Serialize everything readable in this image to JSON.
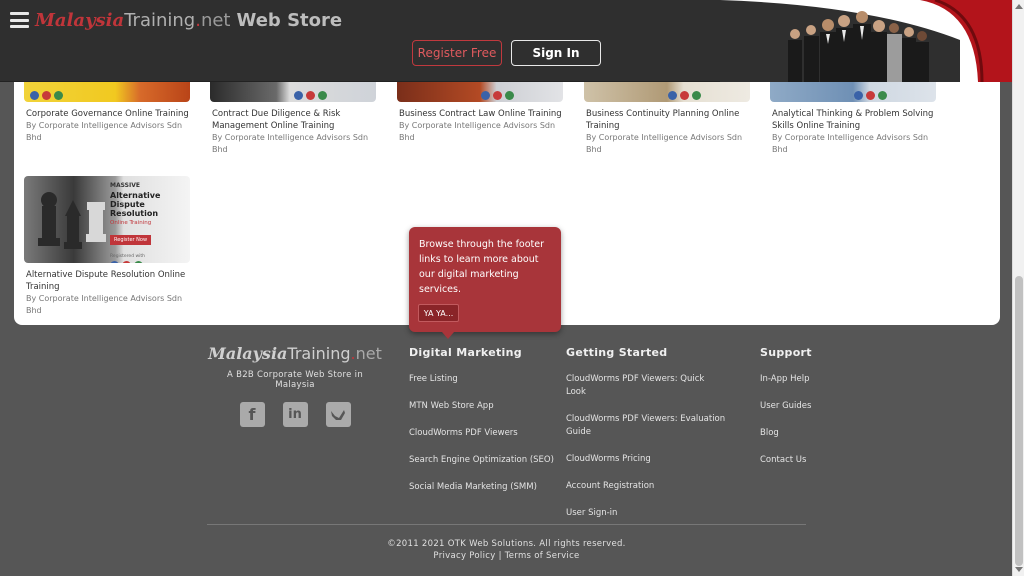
{
  "header": {
    "logo": {
      "malaysia": "Malaysia",
      "training": "Training",
      "dot": ".",
      "net": "net",
      "suffix": "Web Store"
    },
    "register_label": "Register Free",
    "signin_label": "Sign In"
  },
  "courses": [
    {
      "title": "Corporate Governance Online Training",
      "author": "By Corporate Intelligence Advisors Sdn Bhd"
    },
    {
      "title": "Contract Due Diligence & Risk Management Online Training",
      "author": "By Corporate Intelligence Advisors Sdn Bhd"
    },
    {
      "title": "Business Contract Law Online Training",
      "author": "By Corporate Intelligence Advisors Sdn Bhd"
    },
    {
      "title": "Business Continuity Planning Online Training",
      "author": "By Corporate Intelligence Advisors Sdn Bhd"
    },
    {
      "title": "Analytical Thinking & Problem Solving Skills Online Training",
      "author": "By Corporate Intelligence Advisors Sdn Bhd"
    },
    {
      "title": "Alternative Dispute Resolution Online Training",
      "author": "By Corporate Intelligence Advisors Sdn Bhd",
      "thumb_text": {
        "brand": "MASSIVE",
        "title": "Alternative Dispute Resolution",
        "sub": "Online Training",
        "cta": "Register Now",
        "reg": "Registered with"
      }
    }
  ],
  "tooltip": {
    "text": "Browse through the footer links to learn more about our digital marketing services.",
    "button": "YA YA..."
  },
  "footer": {
    "logo": {
      "malaysia": "Malaysia",
      "training": "Training",
      "dot": ".",
      "net": "net"
    },
    "tagline": "A B2B Corporate Web Store in Malaysia",
    "socials": [
      "facebook-icon",
      "linkedin-icon",
      "twitter-icon"
    ],
    "columns": {
      "digital_marketing": {
        "heading": "Digital Marketing",
        "links": [
          "Free Listing",
          "MTN Web Store App",
          "CloudWorms PDF Viewers",
          "Search Engine Optimization (SEO)",
          "Social Media Marketing (SMM)"
        ]
      },
      "getting_started": {
        "heading": "Getting Started",
        "links": [
          "CloudWorms PDF Viewers: Quick Look",
          "CloudWorms PDF Viewers: Evaluation Guide",
          "CloudWorms Pricing",
          "Account Registration",
          "User Sign-in"
        ]
      },
      "support": {
        "heading": "Support",
        "links": [
          "In-App Help",
          "User Guides",
          "Blog",
          "Contact Us"
        ]
      }
    },
    "copyright": "©2011 2021 OTK Web Solutions. All rights reserved.",
    "privacy": "Privacy Policy",
    "separator": " | ",
    "terms": "Terms of Service"
  },
  "colors": {
    "accent": "#c0353a",
    "header_bg": "#2f2f2f",
    "footer_bg": "#565656"
  }
}
